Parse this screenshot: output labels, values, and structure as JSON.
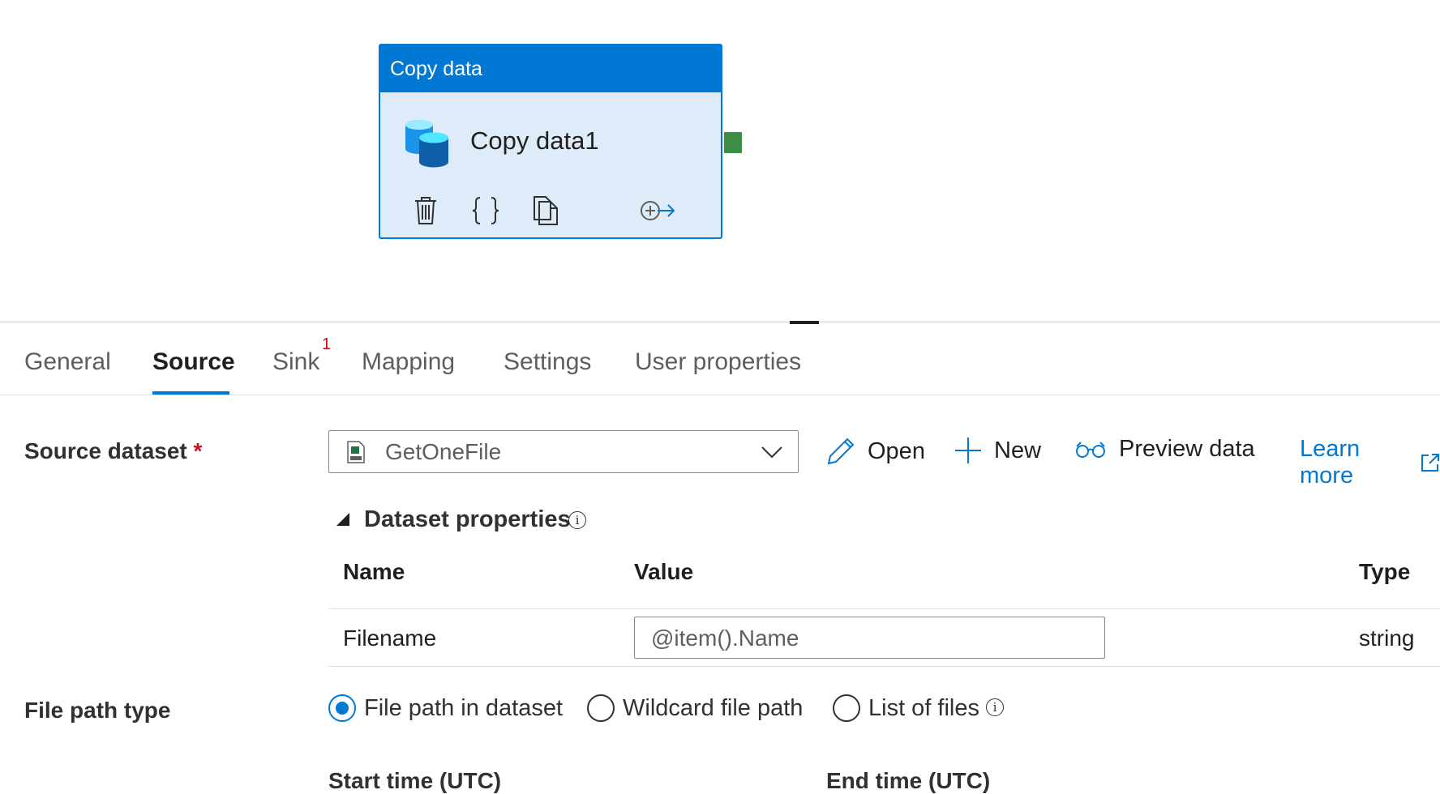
{
  "activity": {
    "header": "Copy data",
    "name": "Copy data1",
    "icons": [
      "database-copy-icon",
      "trash-icon",
      "code-braces-icon",
      "copy-icon",
      "add-output-arrow-icon"
    ]
  },
  "tabs": [
    {
      "label": "General"
    },
    {
      "label": "Source",
      "active": true
    },
    {
      "label": "Sink",
      "badge": "1"
    },
    {
      "label": "Mapping"
    },
    {
      "label": "Settings"
    },
    {
      "label": "User properties"
    }
  ],
  "source_dataset": {
    "label": "Source dataset",
    "required_mark": "*",
    "selected": "GetOneFile",
    "actions": {
      "open": "Open",
      "new": "New",
      "preview": "Preview data",
      "learn_more": "Learn more"
    }
  },
  "dataset_properties": {
    "title": "Dataset properties",
    "columns": {
      "name": "Name",
      "value": "Value",
      "type": "Type"
    },
    "rows": [
      {
        "name": "Filename",
        "value": "@item().Name",
        "type": "string"
      }
    ]
  },
  "file_path_type": {
    "label": "File path type",
    "options": [
      "File path in dataset",
      "Wildcard file path",
      "List of files"
    ],
    "selected": "File path in dataset"
  },
  "time_range": {
    "start_label": "Start time (UTC)",
    "end_label": "End time (UTC)"
  },
  "colors": {
    "accent": "#0078d4",
    "success": "#3b8e44",
    "required": "#c50f1f"
  }
}
